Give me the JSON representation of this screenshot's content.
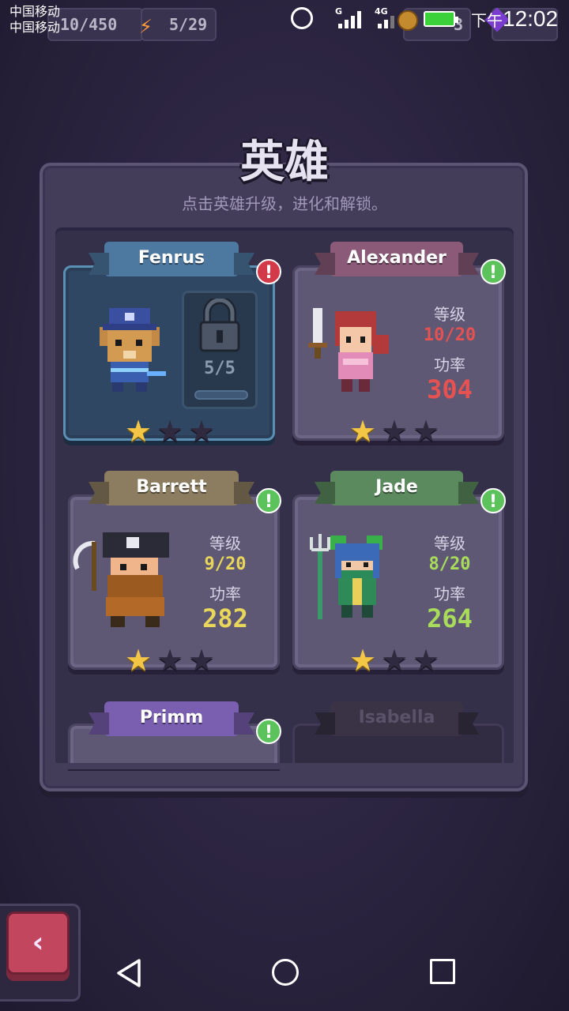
{
  "status_bar": {
    "carrier_1": "中国移动",
    "carrier_2": "中国移动",
    "hearts": "10/450",
    "energy": "5/29",
    "network_1": "G",
    "network_2": "4G",
    "gold_digit": "3",
    "time_prefix": "下午",
    "time": "12:02"
  },
  "title": "英雄",
  "subtitle": "点击英雄升级，进化和解锁。",
  "labels": {
    "level": "等级",
    "power": "功率"
  },
  "heroes": [
    {
      "name": "Fenrus",
      "state": "selected",
      "badge": "!",
      "badge_color": "#d23a4a",
      "banner_color": "#4d78a0",
      "lock_count": "5/5",
      "stars_filled": 1,
      "stars_total": 3
    },
    {
      "name": "Alexander",
      "state": "unlocked",
      "badge": "!",
      "badge_color": "#5cc35c",
      "banner_color": "#8a5a78",
      "level": "10/20",
      "power": "304",
      "level_color": "#e65252",
      "power_color": "#e65252",
      "stars_filled": 1,
      "stars_total": 3
    },
    {
      "name": "Barrett",
      "state": "unlocked",
      "badge": "!",
      "badge_color": "#5cc35c",
      "banner_color": "#8d7d60",
      "level": "9/20",
      "power": "282",
      "level_color": "#e8d75a",
      "power_color": "#e8d75a",
      "stars_filled": 1,
      "stars_total": 3
    },
    {
      "name": "Jade",
      "state": "unlocked",
      "badge": "!",
      "badge_color": "#5cc35c",
      "banner_color": "#5b8a5f",
      "level": "8/20",
      "power": "264",
      "level_color": "#a8dc5a",
      "power_color": "#a8dc5a",
      "stars_filled": 1,
      "stars_total": 3
    },
    {
      "name": "Primm",
      "state": "unlocked",
      "badge": "!",
      "badge_color": "#5cc35c",
      "banner_color": "#7a5fb0"
    },
    {
      "name": "Isabella",
      "state": "locked",
      "banner_color": "#3a3346"
    }
  ],
  "back_button": {
    "label": "‹"
  }
}
